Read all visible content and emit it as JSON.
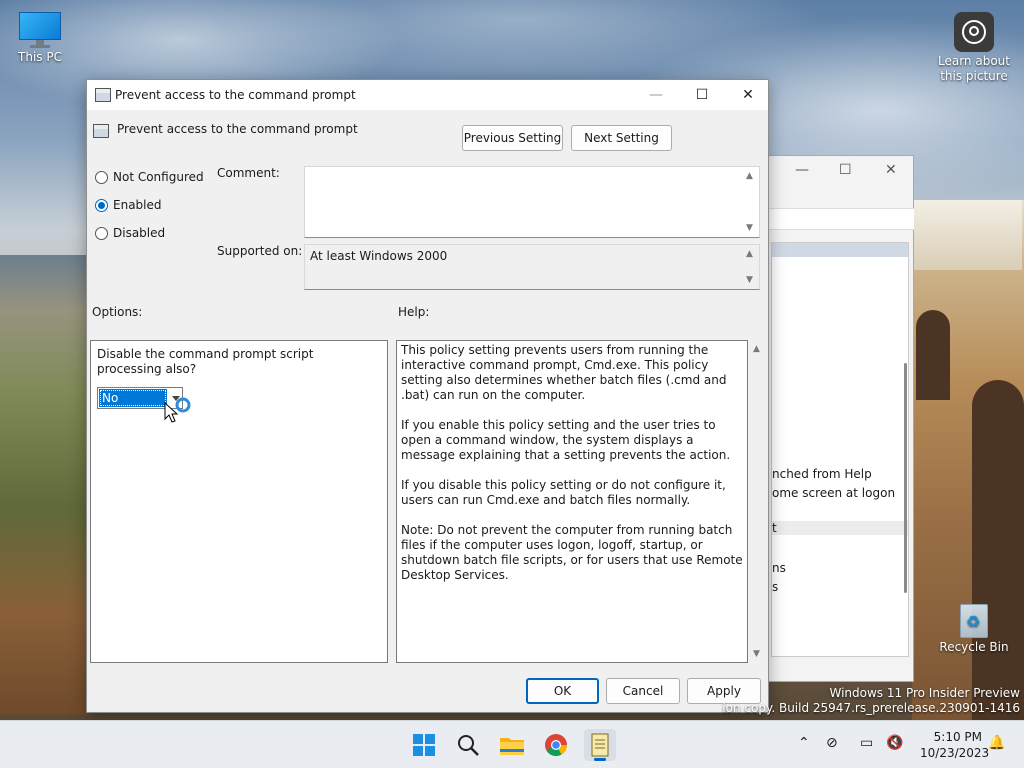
{
  "desktop": {
    "icons": [
      {
        "label": "This PC"
      },
      {
        "label": "Learn about this picture"
      },
      {
        "label": "Recycle Bin"
      }
    ],
    "watermark": {
      "line1": "Windows 11 Pro Insider Preview",
      "line2": "ion copy. Build 25947.rs_prerelease.230901-1416"
    }
  },
  "background_window": {
    "rows": [
      "nched from Help",
      "ome screen at logon",
      "t",
      "ns",
      "s"
    ]
  },
  "dialog": {
    "title": "Prevent access to the command prompt",
    "heading": "Prevent access to the command prompt",
    "previous_label": "Previous Setting",
    "next_label": "Next Setting",
    "state_options": [
      {
        "label": "Not Configured",
        "selected": false
      },
      {
        "label": "Enabled",
        "selected": true
      },
      {
        "label": "Disabled",
        "selected": false
      }
    ],
    "comment_label": "Comment:",
    "comment_value": "",
    "supported_label": "Supported on:",
    "supported_value": "At least Windows 2000",
    "options_label": "Options:",
    "help_label": "Help:",
    "option_prompt": "Disable the command prompt script processing also?",
    "option_value": "No",
    "help_paragraphs": [
      "This policy setting prevents users from running the interactive command prompt, Cmd.exe.  This policy setting also determines whether batch files (.cmd and .bat) can run on the computer.",
      "If you enable this policy setting and the user tries to open a command window, the system displays a message explaining that a setting prevents the action.",
      "If you disable this policy setting or do not configure it, users can run Cmd.exe and batch files normally.",
      "Note: Do not prevent the computer from running batch files if the computer uses logon, logoff, startup, or shutdown batch file scripts, or for users that use Remote Desktop Services."
    ],
    "ok_label": "OK",
    "cancel_label": "Cancel",
    "apply_label": "Apply"
  },
  "taskbar": {
    "time": "5:10 PM",
    "date": "10/23/2023",
    "apps": [
      "start-icon",
      "search-icon",
      "file-explorer-icon",
      "chrome-icon",
      "notepad-icon"
    ],
    "accent": "#0067c0"
  }
}
